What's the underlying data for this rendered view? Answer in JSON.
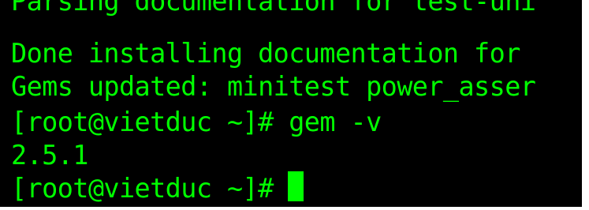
{
  "colors": {
    "background": "#000000",
    "foreground": "#00ff00"
  },
  "terminal": {
    "lines": [
      "Parsing documentation for test-uni",
      "Done installing documentation for",
      "Gems updated: minitest power_asser",
      "[root@vietduc ~]# gem -v",
      "2.5.1",
      "[root@vietduc ~]#"
    ]
  }
}
